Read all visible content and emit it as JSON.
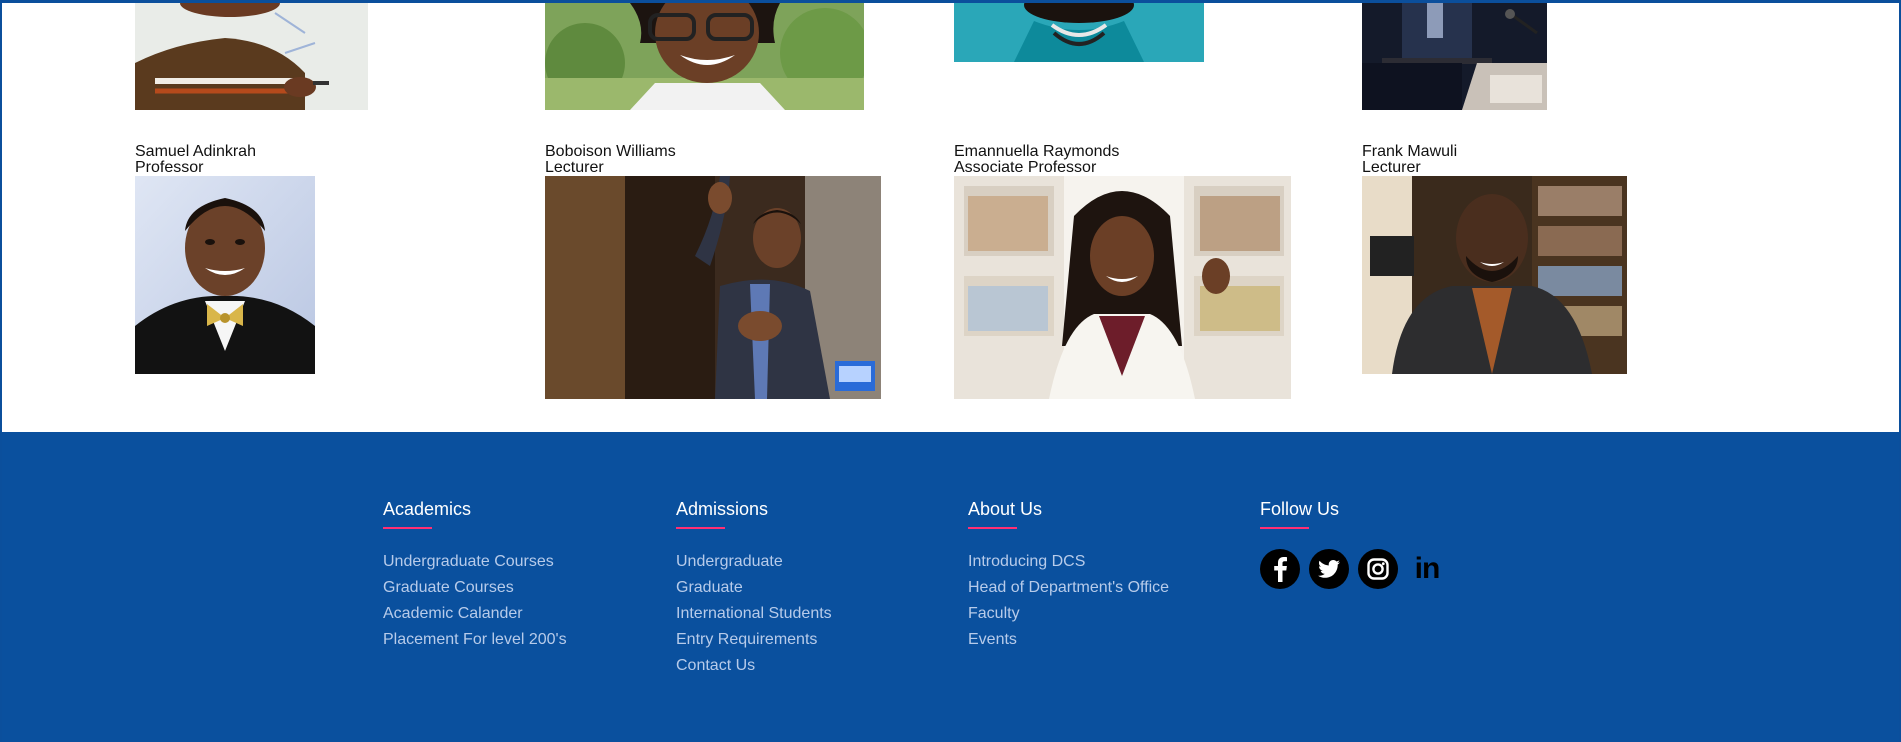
{
  "faculty": [
    {
      "name": "Samuel Adinkrah",
      "title": "Professor"
    },
    {
      "name": "Boboison Williams",
      "title": "Lecturer"
    },
    {
      "name": "Emannuella Raymonds",
      "title": "Associate Professor"
    },
    {
      "name": "Frank Mawuli",
      "title": "Lecturer"
    }
  ],
  "footer": {
    "academics": {
      "heading": "Academics",
      "links": [
        "Undergraduate Courses",
        "Graduate Courses",
        "Academic Calander",
        "Placement For level 200's"
      ]
    },
    "admissions": {
      "heading": "Admissions",
      "links": [
        "Undergraduate",
        "Graduate",
        "International Students",
        "Entry Requirements",
        "Contact Us"
      ]
    },
    "about": {
      "heading": "About Us",
      "links": [
        "Introducing DCS",
        "Head of Department's Office",
        "Faculty",
        "Events"
      ]
    },
    "follow": {
      "heading": "Follow Us",
      "icons": [
        "facebook-icon",
        "twitter-icon",
        "instagram-icon",
        "linkedin-icon"
      ],
      "linkedin_glyph": "in"
    }
  },
  "colors": {
    "footer_bg": "#0a509e",
    "accent": "#ff2f74",
    "footer_link": "#b7cbea",
    "footer_heading": "#ffffff"
  }
}
